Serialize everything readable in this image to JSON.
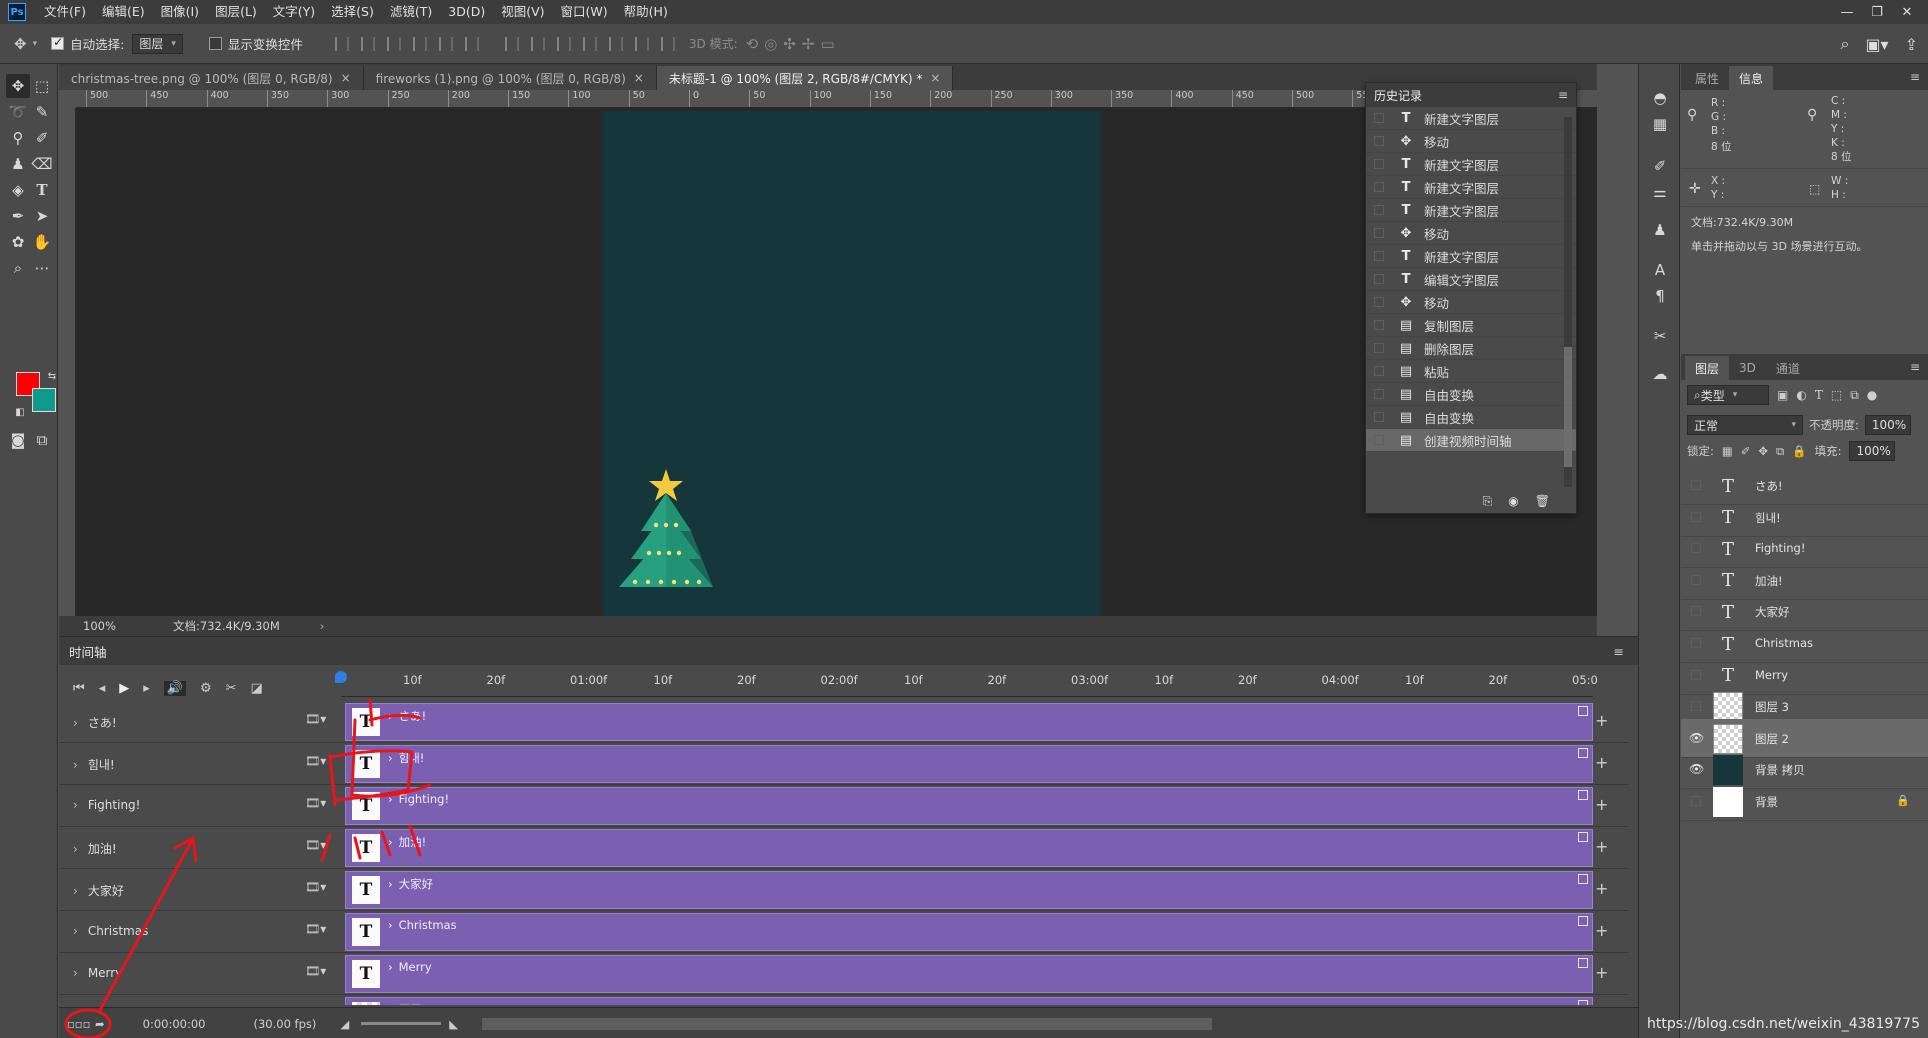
{
  "menu": [
    "文件(F)",
    "编辑(E)",
    "图像(I)",
    "图层(L)",
    "文字(Y)",
    "选择(S)",
    "滤镜(T)",
    "3D(D)",
    "视图(V)",
    "窗口(W)",
    "帮助(H)"
  ],
  "app_logo": "Ps",
  "options": {
    "auto_select_label": "自动选择:",
    "auto_select_value": "图层",
    "show_transform_label": "显示变换控件",
    "mode3d_label": "3D 模式:"
  },
  "tabs": [
    {
      "label": "christmas-tree.png @ 100% (图层 0, RGB/8)",
      "close": "×"
    },
    {
      "label": "fireworks (1).png @ 100% (图层 0, RGB/8)",
      "close": "×"
    },
    {
      "label": "未标题-1 @ 100% (图层 2, RGB/8#/CMYK) *",
      "close": "×"
    }
  ],
  "ruler_top": [
    "500",
    "450",
    "400",
    "350",
    "300",
    "250",
    "200",
    "150",
    "100",
    "50",
    "0",
    "50",
    "100",
    "150",
    "200",
    "250",
    "300",
    "350",
    "400",
    "450",
    "500",
    "550",
    "600",
    "650",
    "700"
  ],
  "status": {
    "zoom": "100%",
    "doc": "文档:732.4K/9.30M"
  },
  "history": {
    "title": "历史记录",
    "items": [
      {
        "icon": "T",
        "label": "新建文字图层"
      },
      {
        "icon": "✥",
        "label": "移动"
      },
      {
        "icon": "T",
        "label": "新建文字图层"
      },
      {
        "icon": "T",
        "label": "新建文字图层"
      },
      {
        "icon": "T",
        "label": "新建文字图层"
      },
      {
        "icon": "✥",
        "label": "移动"
      },
      {
        "icon": "T",
        "label": "新建文字图层"
      },
      {
        "icon": "T",
        "label": "编辑文字图层"
      },
      {
        "icon": "✥",
        "label": "移动"
      },
      {
        "icon": "▤",
        "label": "复制图层"
      },
      {
        "icon": "▤",
        "label": "删除图层"
      },
      {
        "icon": "▤",
        "label": "粘贴"
      },
      {
        "icon": "▤",
        "label": "自由变换"
      },
      {
        "icon": "▤",
        "label": "自由变换"
      },
      {
        "icon": "▤",
        "label": "创建视频时间轴"
      }
    ]
  },
  "timeline": {
    "title": "时间轴",
    "ticks": [
      "10f",
      "20f",
      "01:00f",
      "10f",
      "20f",
      "02:00f",
      "10f",
      "20f",
      "03:00f",
      "10f",
      "20f",
      "04:00f",
      "10f",
      "20f",
      "05:0"
    ],
    "tracks": [
      {
        "name": "さあ!",
        "label": "さあ!",
        "thumb": "T"
      },
      {
        "name": "힘내!",
        "label": "힘내!",
        "thumb": "T"
      },
      {
        "name": "Fighting!",
        "label": "Fighting!",
        "thumb": "T"
      },
      {
        "name": "加油!",
        "label": "加油!",
        "thumb": "T"
      },
      {
        "name": "大家好",
        "label": "大家好",
        "thumb": "T"
      },
      {
        "name": "Christmas",
        "label": "Christmas",
        "thumb": "T"
      },
      {
        "name": "Merry",
        "label": "Merry",
        "thumb": "T"
      },
      {
        "name": "",
        "label": "图层 3",
        "thumb": ""
      }
    ],
    "time": "0:00:00:00",
    "fps": "(30.00 fps)"
  },
  "info_panel": {
    "tabs": [
      "属性",
      "信息"
    ],
    "rgb_labels": "R :\nG :\nB :",
    "cmyk_labels": "C :\nM :\nY :\nK :",
    "bits1": "8 位",
    "bits2": "8 位",
    "xy_labels": "X :\nY :",
    "wh_labels": "W :\nH :",
    "doc": "文档:732.4K/9.30M",
    "hint": "单击并拖动以与 3D 场景进行互动。"
  },
  "layers_panel": {
    "tabs": [
      "图层",
      "3D",
      "通道"
    ],
    "filter_label": "类型",
    "blend_mode": "正常",
    "opacity_label": "不透明度:",
    "opacity": "100%",
    "lock_label": "锁定:",
    "fill_label": "填充:",
    "fill": "100%",
    "layers": [
      {
        "name": "さあ!",
        "type": "text",
        "visible": false
      },
      {
        "name": "힘내!",
        "type": "text",
        "visible": false
      },
      {
        "name": "Fighting!",
        "type": "text",
        "visible": false
      },
      {
        "name": "加油!",
        "type": "text",
        "visible": false
      },
      {
        "name": "大家好",
        "type": "text",
        "visible": false
      },
      {
        "name": "Christmas",
        "type": "text",
        "visible": false
      },
      {
        "name": "Merry",
        "type": "text",
        "visible": false
      },
      {
        "name": "图层 3",
        "type": "checker",
        "visible": false
      },
      {
        "name": "图层 2",
        "type": "checker",
        "visible": true,
        "selected": true
      },
      {
        "name": "背景 拷贝",
        "type": "dark",
        "visible": true
      },
      {
        "name": "背景",
        "type": "white",
        "visible": false,
        "locked": true
      }
    ]
  },
  "annotation_text": "点",
  "watermark": "https://blog.csdn.net/weixin_43819775",
  "colors": {
    "foreground": "#ff0000",
    "background": "#119a8a",
    "canvas": "#15363a",
    "track": "#7b5fb0",
    "annotation": "#e8151b"
  }
}
